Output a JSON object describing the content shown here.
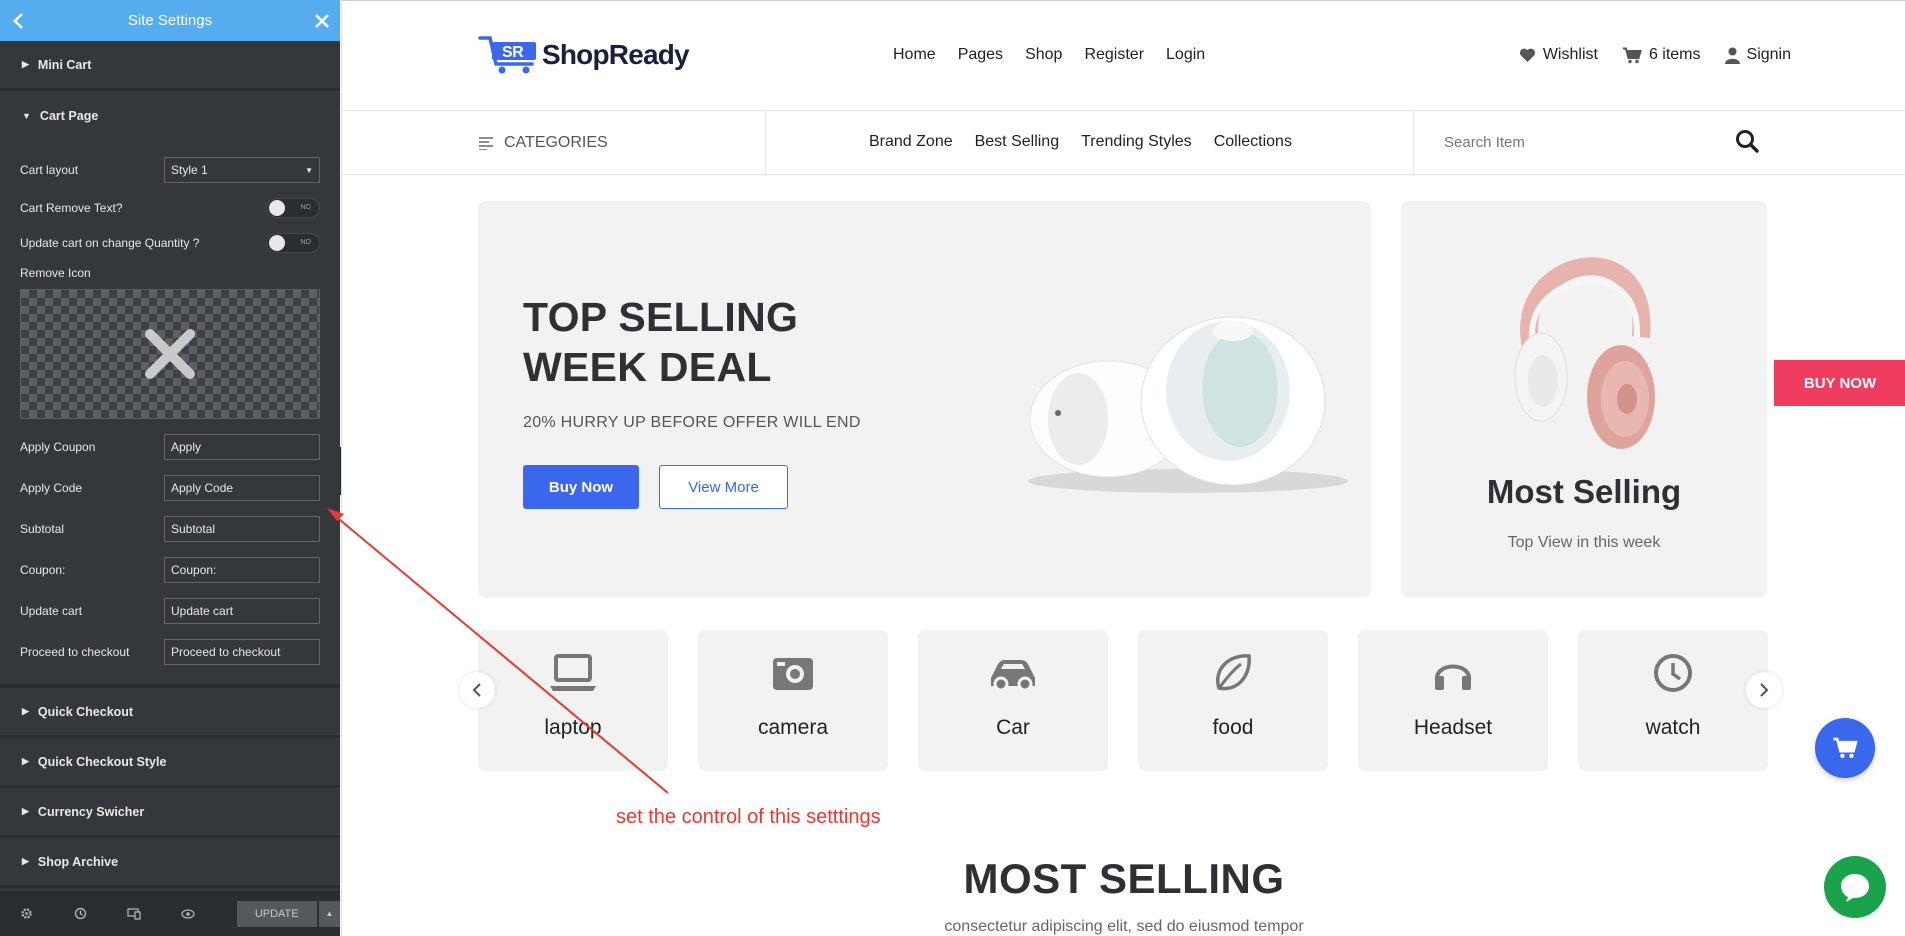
{
  "panel": {
    "title": "Site Settings",
    "sections": {
      "mini_cart": "Mini Cart",
      "cart_page": "Cart Page",
      "quick_checkout": "Quick Checkout",
      "quick_checkout_style": "Quick Checkout Style",
      "currency_swicher": "Currency Swicher",
      "shop_archive": "Shop Archive"
    },
    "cart_layout": {
      "label": "Cart layout",
      "value": "Style 1"
    },
    "cart_remove_text": {
      "label": "Cart Remove Text?",
      "toggle": "NO"
    },
    "update_cart_qty": {
      "label": "Update cart on change Quantity ?",
      "toggle": "NO"
    },
    "remove_icon": {
      "label": "Remove Icon"
    },
    "fields": [
      {
        "label": "Apply Coupon",
        "value": "Apply"
      },
      {
        "label": "Apply Code",
        "value": "Apply Code"
      },
      {
        "label": "Subtotal",
        "value": "Subtotal"
      },
      {
        "label": "Coupon:",
        "value": "Coupon:"
      },
      {
        "label": "Update cart",
        "value": "Update cart"
      },
      {
        "label": "Proceed to checkout",
        "value": "Proceed to checkout"
      }
    ],
    "footer": {
      "update_label": "UPDATE"
    },
    "colors": {
      "header": "#55acee",
      "background": "#34383c"
    }
  },
  "site": {
    "logo_text": "ShopReady",
    "logo_mark": "SR",
    "main_nav": [
      "Home",
      "Pages",
      "Shop",
      "Register",
      "Login"
    ],
    "user_nav": {
      "wishlist": "Wishlist",
      "cart": "6 items",
      "signin": "Signin"
    },
    "categories_label": "CATEGORIES",
    "category_nav": [
      "Brand Zone",
      "Best Selling",
      "Trending Styles",
      "Collections"
    ],
    "search_placeholder": "Search Item",
    "hero": {
      "title_line1": "TOP SELLING",
      "title_line2": "WEEK DEAL",
      "subtitle": "20% HURRY UP BEFORE OFFER WILL END",
      "buy_label": "Buy Now",
      "view_label": "View More"
    },
    "side_card": {
      "title": "Most Selling",
      "subtitle": "Top View in this week"
    },
    "float_buy": "BUY NOW",
    "category_cards": [
      {
        "label": "laptop",
        "icon": "laptop-icon"
      },
      {
        "label": "camera",
        "icon": "camera-icon"
      },
      {
        "label": "Car",
        "icon": "car-icon"
      },
      {
        "label": "food",
        "icon": "leaf-icon"
      },
      {
        "label": "Headset",
        "icon": "headset-icon"
      },
      {
        "label": "watch",
        "icon": "clock-icon"
      }
    ],
    "section_title": "MOST SELLING",
    "section_subtitle": "consectetur adipiscing elit, sed do eiusmod tempor",
    "colors": {
      "primary": "#3a67ec",
      "buy_now": "#ef3d5f",
      "chat": "#1aa34a"
    }
  },
  "annotation": {
    "text": "set  the control of this setttings",
    "color": "#e53935"
  }
}
